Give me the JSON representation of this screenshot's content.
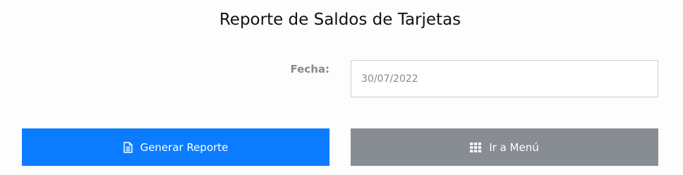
{
  "page": {
    "title": "Reporte de Saldos de Tarjetas"
  },
  "form": {
    "fecha_label": "Fecha:",
    "fecha_value": "30/07/2022"
  },
  "actions": {
    "generate_label": "Generar Reporte",
    "generate_icon": "file-text-icon",
    "menu_label": "Ir a Menú",
    "menu_icon": "grid-icon"
  },
  "colors": {
    "primary_button": "#0b7cff",
    "secondary_button": "#878d93"
  }
}
